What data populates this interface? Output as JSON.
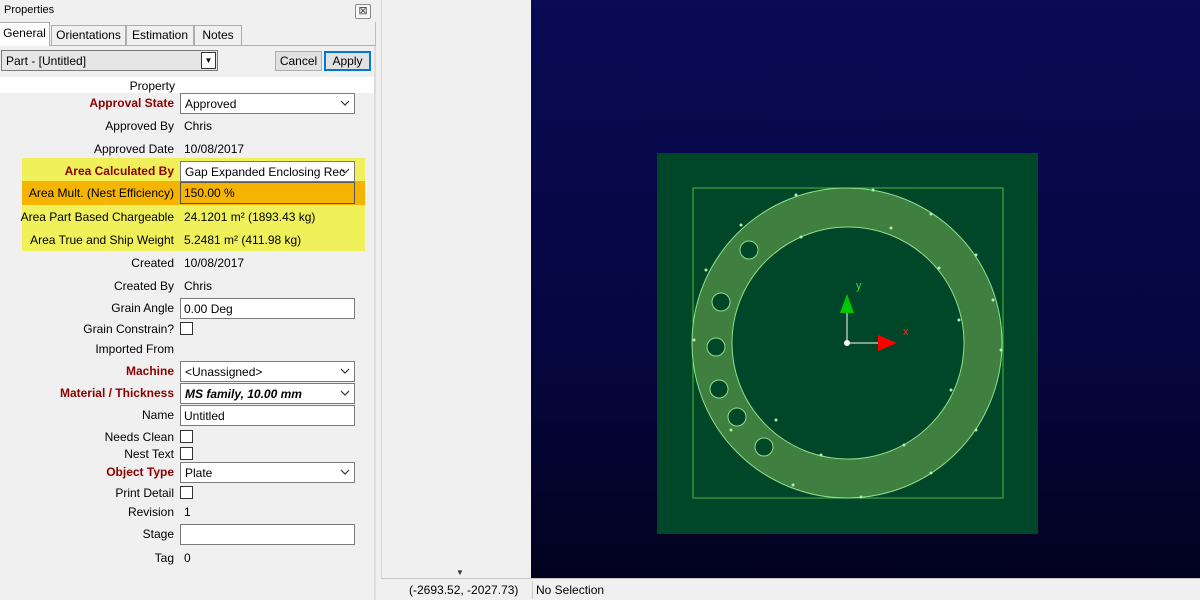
{
  "panel": {
    "title": "Properties",
    "close_glyph": "⊠",
    "tabs": [
      "General",
      "Orientations",
      "Estimation",
      "Notes"
    ],
    "part_select": "Part - [Untitled]",
    "cancel_label": "Cancel",
    "apply_label": "Apply",
    "property_header": "Property"
  },
  "properties": {
    "approval_state": {
      "label": "Approval State",
      "value": "Approved"
    },
    "approved_by": {
      "label": "Approved By",
      "value": "Chris"
    },
    "approved_date": {
      "label": "Approved Date",
      "value": "10/08/2017"
    },
    "area_calculated_by": {
      "label": "Area Calculated By",
      "value": "Gap Expanded Enclosing Rec"
    },
    "area_mult": {
      "label": "Area Mult. (Nest Efficiency)",
      "value": "150.00 %"
    },
    "area_part_chargeable": {
      "label": "Area Part Based Chargeable",
      "value": "24.1201 m² (1893.43 kg)"
    },
    "area_true_ship": {
      "label": "Area True and Ship Weight",
      "value": "5.2481 m² (411.98 kg)"
    },
    "created": {
      "label": "Created",
      "value": "10/08/2017"
    },
    "created_by": {
      "label": "Created By",
      "value": "Chris"
    },
    "grain_angle": {
      "label": "Grain Angle",
      "value": "0.00 Deg"
    },
    "grain_constrain": {
      "label": "Grain Constrain?"
    },
    "imported_from": {
      "label": "Imported From",
      "value": ""
    },
    "machine": {
      "label": "Machine",
      "value": "<Unassigned>"
    },
    "material": {
      "label": "Material / Thickness",
      "value": "MS family, 10.00 mm"
    },
    "name": {
      "label": "Name",
      "value": "Untitled"
    },
    "needs_clean": {
      "label": "Needs Clean"
    },
    "nest_text": {
      "label": "Nest Text"
    },
    "object_type": {
      "label": "Object Type",
      "value": "Plate"
    },
    "print_detail": {
      "label": "Print Detail"
    },
    "revision": {
      "label": "Revision",
      "value": "1"
    },
    "stage": {
      "label": "Stage",
      "value": ""
    },
    "tag": {
      "label": "Tag",
      "value": "0"
    }
  },
  "viewport": {
    "axis_x_label": "x",
    "axis_y_label": "y",
    "colors": {
      "background": "#0a0a55",
      "plate": "#004628",
      "ring": "#3f7f3f",
      "outline": "#5fd35f",
      "axis_x": "#ff0000",
      "axis_y": "#00c800"
    }
  },
  "status": {
    "coords": "(-2693.52, -2027.73)",
    "selection": "No Selection"
  }
}
